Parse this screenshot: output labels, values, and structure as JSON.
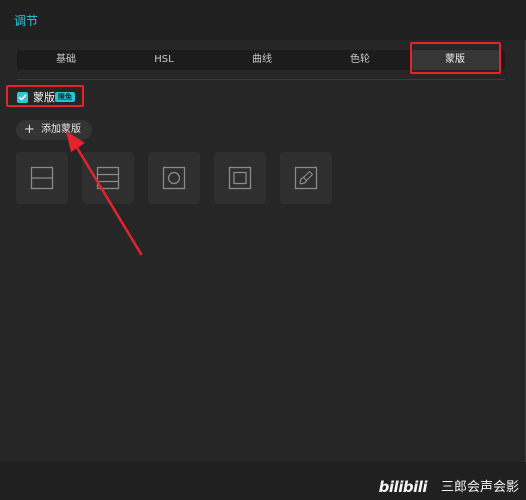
{
  "panel": {
    "title": "调节"
  },
  "tabs": [
    {
      "label": "基础",
      "active": false
    },
    {
      "label": "HSL",
      "active": false
    },
    {
      "label": "曲线",
      "active": false
    },
    {
      "label": "色轮",
      "active": false
    },
    {
      "label": "蒙版",
      "active": true
    }
  ],
  "mask": {
    "enabled": true,
    "label": "蒙版",
    "badge": "限免",
    "add_button_label": "添加蒙版",
    "add_icon": "plus-icon",
    "presets": [
      {
        "icon": "split-horizontal-icon"
      },
      {
        "icon": "mirror-band-icon"
      },
      {
        "icon": "circle-mask-icon"
      },
      {
        "icon": "rectangle-mask-icon"
      },
      {
        "icon": "brush-mask-icon"
      }
    ]
  },
  "annotations": {
    "highlight_color": "#e3242b"
  },
  "watermark": {
    "logo": "bilibili",
    "text": "三郎会声会影"
  },
  "colors": {
    "accent": "#28c8d8",
    "panel_bg": "#262626"
  }
}
